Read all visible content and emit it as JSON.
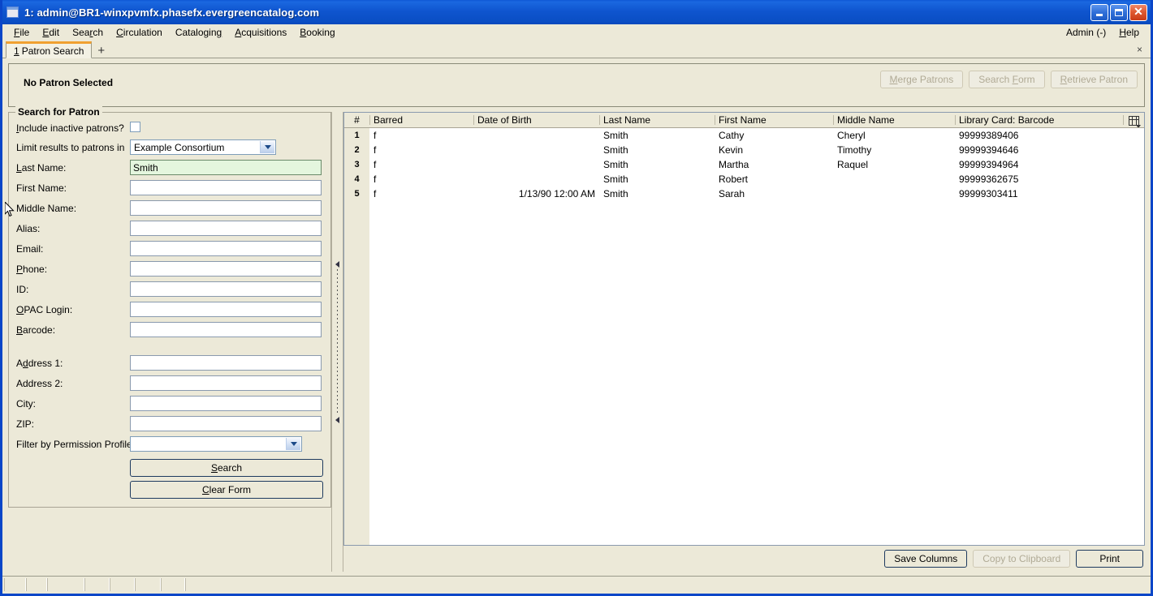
{
  "window": {
    "title": "1: admin@BR1-winxpvmfx.phasefx.evergreencatalog.com",
    "min_label": "",
    "max_label": "",
    "close_label": "✕"
  },
  "menubar": {
    "items": [
      {
        "label": "File",
        "accesskey": "F"
      },
      {
        "label": "Edit",
        "accesskey": "E"
      },
      {
        "label": "Search",
        "accesskey": "r"
      },
      {
        "label": "Circulation",
        "accesskey": "C"
      },
      {
        "label": "Cataloging",
        "accesskey": "g"
      },
      {
        "label": "Acquisitions",
        "accesskey": "A"
      },
      {
        "label": "Booking",
        "accesskey": "B"
      }
    ],
    "admin_label": "Admin (-)",
    "help_label": "Help"
  },
  "tabs": {
    "items": [
      {
        "number": "1",
        "label": "Patron Search"
      }
    ],
    "add_label": "+",
    "close_label": "×"
  },
  "patron_bar": {
    "status": "No Patron Selected",
    "actions": [
      {
        "label": "Merge Patrons",
        "disabled": true
      },
      {
        "label": "Search Form",
        "disabled": true
      },
      {
        "label": "Retrieve Patron",
        "disabled": true
      }
    ]
  },
  "search_form": {
    "legend": "Search for Patron",
    "include_inactive_label": "Include inactive patrons?",
    "include_inactive_checked": false,
    "limit_results_label": "Limit results to patrons in",
    "limit_results_value": "Example Consortium",
    "fields": [
      {
        "label": "Last Name:",
        "value": "Smith",
        "focused": true
      },
      {
        "label": "First Name:",
        "value": "",
        "focused": false
      },
      {
        "label": "Middle Name:",
        "value": "",
        "focused": false
      },
      {
        "label": "Alias:",
        "value": "",
        "focused": false
      },
      {
        "label": "Email:",
        "value": "",
        "focused": false
      },
      {
        "label": "Phone:",
        "value": "",
        "focused": false
      },
      {
        "label": "ID:",
        "value": "",
        "focused": false
      },
      {
        "label": "OPAC Login:",
        "value": "",
        "focused": false
      },
      {
        "label": "Barcode:",
        "value": "",
        "focused": false
      }
    ],
    "address_fields": [
      {
        "label": "Address 1:",
        "value": ""
      },
      {
        "label": "Address 2:",
        "value": ""
      },
      {
        "label": "City:",
        "value": ""
      },
      {
        "label": "ZIP:",
        "value": ""
      }
    ],
    "permission_profile_label": "Filter by Permission Profile:",
    "permission_profile_value": "",
    "search_button": "Search",
    "clear_button": "Clear Form"
  },
  "results": {
    "columns": [
      "#",
      "Barred",
      "Date of Birth",
      "Last Name",
      "First Name",
      "Middle Name",
      "Library Card: Barcode"
    ],
    "rows": [
      {
        "num": "1",
        "barred": "f",
        "dob": "",
        "last": "Smith",
        "first": "Cathy",
        "middle": "Cheryl",
        "barcode": "99999389406"
      },
      {
        "num": "2",
        "barred": "f",
        "dob": "",
        "last": "Smith",
        "first": "Kevin",
        "middle": "Timothy",
        "barcode": "99999394646"
      },
      {
        "num": "3",
        "barred": "f",
        "dob": "",
        "last": "Smith",
        "first": "Martha",
        "middle": "Raquel",
        "barcode": "99999394964"
      },
      {
        "num": "4",
        "barred": "f",
        "dob": "",
        "last": "Smith",
        "first": "Robert",
        "middle": "",
        "barcode": "99999362675"
      },
      {
        "num": "5",
        "barred": "f",
        "dob": "1/13/90 12:00 AM",
        "last": "Smith",
        "first": "Sarah",
        "middle": "",
        "barcode": "99999303411"
      }
    ],
    "actions": [
      {
        "label": "Save Columns",
        "disabled": false
      },
      {
        "label": "Copy to Clipboard",
        "disabled": true
      },
      {
        "label": "Print",
        "disabled": false
      }
    ]
  },
  "colors": {
    "titlebar_blue": "#0f55cf",
    "window_border": "#0a46c8",
    "face": "#ece9d8",
    "tab_accent": "#f0a030",
    "focused_field": "#e4f6de"
  }
}
